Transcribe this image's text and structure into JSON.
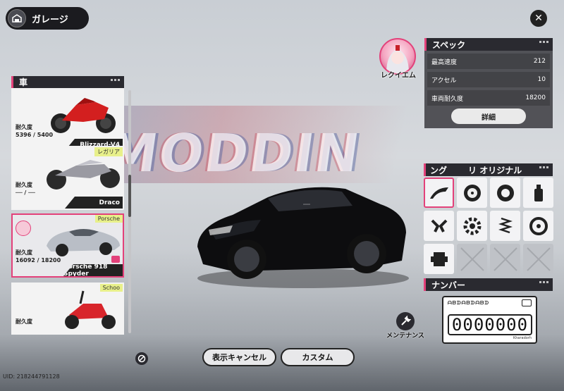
{
  "header": {
    "title": "ガレージ",
    "icon": "garage-icon"
  },
  "background_text": "MODDIN",
  "car_list": {
    "title": "車",
    "cars": [
      {
        "name": "Blizzard-V4",
        "durability_label": "耐久度",
        "durability": "5396 / 5400",
        "brand": "",
        "image": "red-sport-motorcycle"
      },
      {
        "name": "Draco",
        "durability_label": "耐久度",
        "durability": "── / ──",
        "brand": "レガリア",
        "image": "futuristic-motorcycle"
      },
      {
        "name": "Porsche 918 Spyder",
        "durability_label": "耐久度",
        "durability": "16092 / 18200",
        "brand": "Porsche",
        "image": "silver-porsche-918",
        "selected": true
      },
      {
        "name": "",
        "durability_label": "耐久度",
        "durability": "",
        "brand": "Schoo",
        "image": "red-scooter"
      }
    ]
  },
  "avatar": {
    "name": "レクイエム"
  },
  "spec": {
    "title": "スペック",
    "rows": [
      {
        "label": "最高速度",
        "value": "212"
      },
      {
        "label": "アクセル",
        "value": "10"
      },
      {
        "label": "車両耐久度",
        "value": "18200"
      }
    ],
    "detail_button": "詳細"
  },
  "tuning": {
    "header_left": "ング",
    "header_right": "リ オリジナル",
    "items": [
      {
        "icon": "aero-icon",
        "selected": true,
        "locked": false
      },
      {
        "icon": "wheel-icon",
        "selected": false,
        "locked": false
      },
      {
        "icon": "tire-icon",
        "selected": false,
        "locked": false
      },
      {
        "icon": "spray-paint-icon",
        "selected": false,
        "locked": false
      },
      {
        "icon": "piston-icon",
        "selected": false,
        "locked": false
      },
      {
        "icon": "gear-icon",
        "selected": false,
        "locked": false
      },
      {
        "icon": "suspension-icon",
        "selected": false,
        "locked": false
      },
      {
        "icon": "brake-disc-icon",
        "selected": false,
        "locked": false
      },
      {
        "icon": "transmission-icon",
        "selected": false,
        "locked": false
      },
      {
        "icon": "locked-slot-icon",
        "selected": false,
        "locked": true
      },
      {
        "icon": "locked-slot-icon",
        "selected": false,
        "locked": true
      },
      {
        "icon": "locked-slot-icon",
        "selected": false,
        "locked": true
      }
    ]
  },
  "plate": {
    "title": "ナンバー",
    "top_text": "ᗩᗷᗪᗩᗷᗪᗩᗷᗪ",
    "number": "0000000",
    "bottom_text": "Kharadorh"
  },
  "buttons": {
    "hide_cancel": "表示キャンセル",
    "custom": "カスタム"
  },
  "maintenance": {
    "label": "メンテナンス"
  },
  "uid": "UID: 218244791128",
  "colors": {
    "accent": "#e3417a",
    "panel": "#2a2a30",
    "card": "#f3f3f3"
  }
}
